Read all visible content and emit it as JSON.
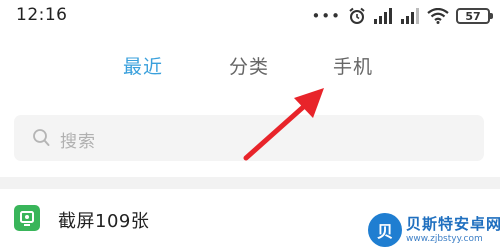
{
  "status_bar": {
    "time": "12:16",
    "dots": "•••",
    "battery": "57",
    "icons": [
      "more-dots-icon",
      "alarm-clock-icon",
      "signal-icon",
      "signal-icon",
      "wifi-icon",
      "battery-icon"
    ]
  },
  "tabs": [
    {
      "label": "最近",
      "active": true
    },
    {
      "label": "分类",
      "active": false
    },
    {
      "label": "手机",
      "active": false
    }
  ],
  "search": {
    "placeholder": "搜索",
    "icon": "search-icon"
  },
  "list": [
    {
      "label": "截屏109张",
      "icon": "screenshot-icon"
    }
  ],
  "annotation": {
    "icon": "red-arrow-icon",
    "color": "#e8242a"
  },
  "watermark": {
    "badge": "贝",
    "name": "贝斯特安卓网",
    "site": "www.zjbstyy.com"
  },
  "colors": {
    "accent": "#3aa0dc",
    "inactive_tab": "#666666",
    "search_bg": "#f4f4f4",
    "item_icon": "#39b55a"
  }
}
